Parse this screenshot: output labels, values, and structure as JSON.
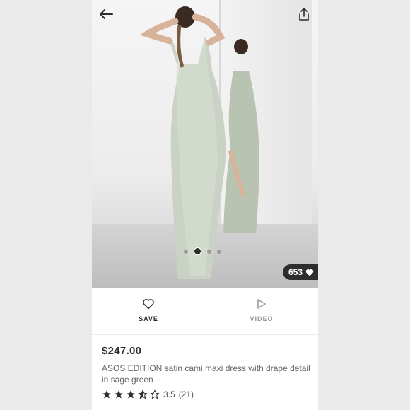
{
  "product": {
    "price": "$247.00",
    "title": "ASOS EDITION satin cami maxi dress with drape detail in sage green",
    "rating_value": "3.5",
    "rating_count": "(21)",
    "rating_stars": 3.5,
    "likes": "653"
  },
  "actions": {
    "save_label": "SAVE",
    "video_label": "VIDEO"
  },
  "gallery": {
    "total_images": 4,
    "active_index": 1
  },
  "icons": {
    "back": "arrow-left-icon",
    "share": "share-icon",
    "like": "heart-icon",
    "save": "heart-outline-icon",
    "video": "play-icon",
    "star": "star-icon"
  },
  "colors": {
    "text_dark": "#2d2d2d",
    "text_muted": "#9b9b9b",
    "dress": "#c8d1c3"
  }
}
